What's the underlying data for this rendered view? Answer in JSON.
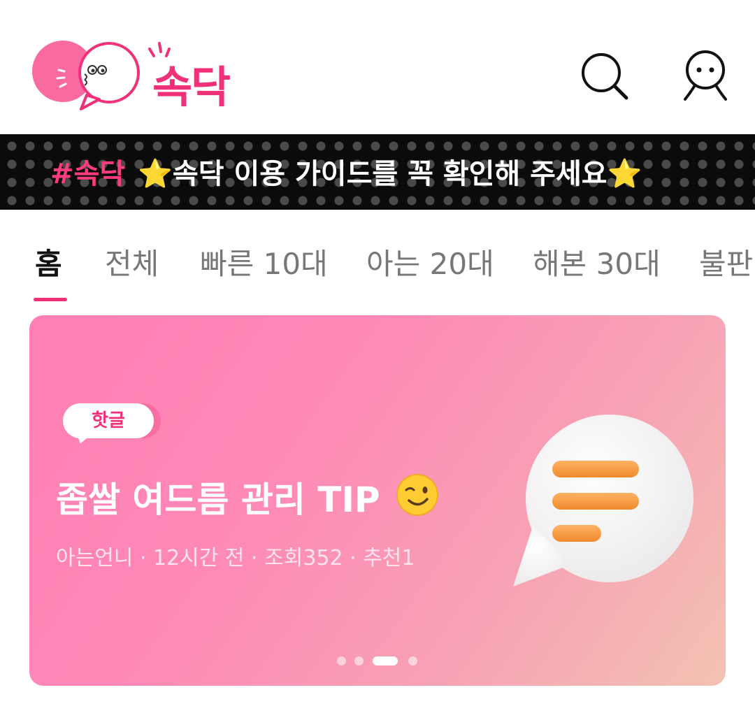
{
  "header": {
    "logo_text": "속닥",
    "search_icon": "search-icon",
    "profile_icon": "profile-icon",
    "brand_color": "#f0317a"
  },
  "notice": {
    "hashtag": "#속닥",
    "message": "⭐속닥 이용 가이드를 꼭 확인해 주세요⭐"
  },
  "tabs": [
    {
      "label": "홈",
      "active": true
    },
    {
      "label": "전체",
      "active": false
    },
    {
      "label": "빠른 10대",
      "active": false
    },
    {
      "label": "아는 20대",
      "active": false
    },
    {
      "label": "해본 30대",
      "active": false
    },
    {
      "label": "불판",
      "active": false
    }
  ],
  "featured": {
    "badge": "핫글",
    "title": "좁쌀 여드름 관리 TIP",
    "emoji_icon": "wink-emoji-icon",
    "meta": "아는언니 · 12시간 전 · 조회352 · 추천1",
    "illustration_icon": "chat-bubble-icon",
    "pager_count": 4,
    "pager_active": 3
  }
}
